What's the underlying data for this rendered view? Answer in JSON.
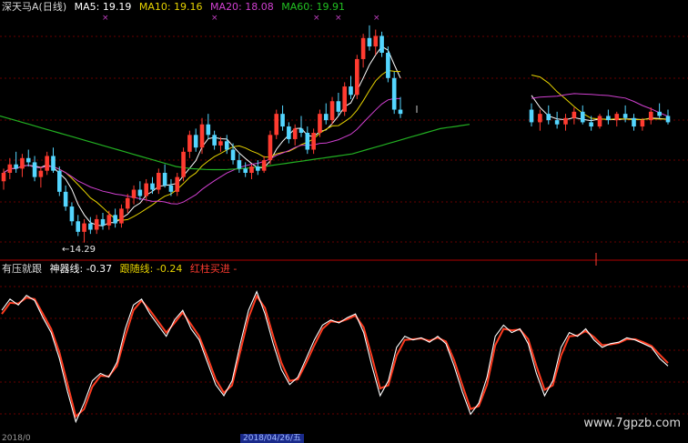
{
  "header": {
    "stock_title": "深天马A(日线)",
    "ma5": "MA5: 19.19",
    "ma10": "MA10: 19.16",
    "ma20": "MA20: 18.08",
    "ma60": "MA60: 19.91"
  },
  "indicator": {
    "name": "有压就跟",
    "shen_label": "神器线: -0.37",
    "gen_label": "跟随线: -0.24",
    "signal_label": "红柱买进 -"
  },
  "annotations": {
    "low_price": "←14.29",
    "date_highlight": "2018/04/26/五",
    "date_left": "2018/0"
  },
  "watermark": "www.7gpzb.com",
  "colors": {
    "up": "#ff3b30",
    "down": "#54d6ff",
    "ma5": "#ffffff",
    "ma10": "#e6d200",
    "ma20": "#d040d0",
    "ma60": "#22b022",
    "osc_main": "#ffffff",
    "osc_follow": "#ff3b1f",
    "grid": "#8b0000"
  },
  "chart_data": {
    "type": "candlestick",
    "ylim": [
      13.8,
      25.2
    ],
    "low_marker": 14.29,
    "candles": [
      {
        "o": 17.2,
        "h": 17.8,
        "l": 16.8,
        "c": 17.6
      },
      {
        "o": 17.6,
        "h": 18.3,
        "l": 17.3,
        "c": 18.0
      },
      {
        "o": 18.0,
        "h": 18.6,
        "l": 17.6,
        "c": 17.8
      },
      {
        "o": 17.8,
        "h": 18.5,
        "l": 17.4,
        "c": 18.3
      },
      {
        "o": 18.3,
        "h": 18.7,
        "l": 17.9,
        "c": 18.1
      },
      {
        "o": 18.1,
        "h": 18.4,
        "l": 17.2,
        "c": 17.4
      },
      {
        "o": 17.4,
        "h": 17.9,
        "l": 16.9,
        "c": 17.7
      },
      {
        "o": 17.7,
        "h": 18.6,
        "l": 17.5,
        "c": 18.4
      },
      {
        "o": 18.4,
        "h": 18.8,
        "l": 17.6,
        "c": 17.7
      },
      {
        "o": 17.7,
        "h": 17.9,
        "l": 16.5,
        "c": 16.7
      },
      {
        "o": 16.7,
        "h": 17.0,
        "l": 15.8,
        "c": 16.0
      },
      {
        "o": 16.0,
        "h": 16.2,
        "l": 15.1,
        "c": 15.3
      },
      {
        "o": 15.3,
        "h": 15.6,
        "l": 14.6,
        "c": 14.8
      },
      {
        "o": 14.8,
        "h": 15.4,
        "l": 14.29,
        "c": 15.2
      },
      {
        "o": 15.2,
        "h": 15.5,
        "l": 14.7,
        "c": 14.9
      },
      {
        "o": 14.9,
        "h": 15.6,
        "l": 14.7,
        "c": 15.4
      },
      {
        "o": 15.4,
        "h": 15.7,
        "l": 14.9,
        "c": 15.1
      },
      {
        "o": 15.1,
        "h": 15.8,
        "l": 14.9,
        "c": 15.6
      },
      {
        "o": 15.6,
        "h": 15.9,
        "l": 15.0,
        "c": 15.2
      },
      {
        "o": 15.2,
        "h": 16.1,
        "l": 15.0,
        "c": 15.9
      },
      {
        "o": 15.9,
        "h": 16.6,
        "l": 15.7,
        "c": 16.4
      },
      {
        "o": 16.4,
        "h": 17.0,
        "l": 16.1,
        "c": 16.8
      },
      {
        "o": 16.8,
        "h": 17.2,
        "l": 16.3,
        "c": 16.5
      },
      {
        "o": 16.5,
        "h": 17.3,
        "l": 16.3,
        "c": 17.1
      },
      {
        "o": 17.1,
        "h": 17.4,
        "l": 16.6,
        "c": 16.8
      },
      {
        "o": 16.8,
        "h": 17.8,
        "l": 16.6,
        "c": 17.6
      },
      {
        "o": 17.6,
        "h": 18.0,
        "l": 16.9,
        "c": 17.0
      },
      {
        "o": 17.0,
        "h": 17.3,
        "l": 16.5,
        "c": 16.7
      },
      {
        "o": 16.7,
        "h": 17.6,
        "l": 16.5,
        "c": 17.4
      },
      {
        "o": 17.4,
        "h": 18.8,
        "l": 17.2,
        "c": 18.6
      },
      {
        "o": 18.6,
        "h": 19.6,
        "l": 18.3,
        "c": 19.4
      },
      {
        "o": 19.4,
        "h": 19.7,
        "l": 18.6,
        "c": 18.8
      },
      {
        "o": 18.8,
        "h": 20.2,
        "l": 18.5,
        "c": 19.9
      },
      {
        "o": 19.9,
        "h": 20.4,
        "l": 19.2,
        "c": 19.4
      },
      {
        "o": 19.4,
        "h": 19.6,
        "l": 18.7,
        "c": 18.9
      },
      {
        "o": 18.9,
        "h": 19.3,
        "l": 18.6,
        "c": 19.1
      },
      {
        "o": 19.1,
        "h": 19.4,
        "l": 18.5,
        "c": 18.7
      },
      {
        "o": 18.7,
        "h": 19.0,
        "l": 18.0,
        "c": 18.2
      },
      {
        "o": 18.2,
        "h": 18.5,
        "l": 17.6,
        "c": 17.8
      },
      {
        "o": 17.8,
        "h": 18.1,
        "l": 17.4,
        "c": 17.6
      },
      {
        "o": 17.6,
        "h": 18.0,
        "l": 17.3,
        "c": 17.9
      },
      {
        "o": 17.9,
        "h": 18.2,
        "l": 17.5,
        "c": 17.7
      },
      {
        "o": 17.7,
        "h": 18.4,
        "l": 17.6,
        "c": 18.2
      },
      {
        "o": 18.2,
        "h": 19.6,
        "l": 18.0,
        "c": 19.4
      },
      {
        "o": 19.4,
        "h": 20.6,
        "l": 19.2,
        "c": 20.4
      },
      {
        "o": 20.4,
        "h": 20.8,
        "l": 19.6,
        "c": 19.8
      },
      {
        "o": 19.8,
        "h": 20.0,
        "l": 19.0,
        "c": 19.2
      },
      {
        "o": 19.2,
        "h": 19.9,
        "l": 18.9,
        "c": 19.7
      },
      {
        "o": 19.7,
        "h": 20.3,
        "l": 19.3,
        "c": 19.5
      },
      {
        "o": 19.5,
        "h": 19.8,
        "l": 18.5,
        "c": 18.7
      },
      {
        "o": 18.7,
        "h": 19.7,
        "l": 18.5,
        "c": 19.5
      },
      {
        "o": 19.5,
        "h": 20.6,
        "l": 19.3,
        "c": 20.4
      },
      {
        "o": 20.4,
        "h": 20.9,
        "l": 19.9,
        "c": 20.1
      },
      {
        "o": 20.1,
        "h": 21.2,
        "l": 19.9,
        "c": 21.0
      },
      {
        "o": 21.0,
        "h": 21.4,
        "l": 20.3,
        "c": 20.5
      },
      {
        "o": 20.5,
        "h": 21.9,
        "l": 20.3,
        "c": 21.7
      },
      {
        "o": 21.7,
        "h": 22.2,
        "l": 21.1,
        "c": 21.3
      },
      {
        "o": 21.3,
        "h": 23.2,
        "l": 21.1,
        "c": 23.0
      },
      {
        "o": 23.0,
        "h": 24.2,
        "l": 22.6,
        "c": 24.0
      },
      {
        "o": 24.0,
        "h": 24.6,
        "l": 23.4,
        "c": 23.6
      },
      {
        "o": 23.6,
        "h": 24.4,
        "l": 23.2,
        "c": 24.1
      },
      {
        "o": 24.1,
        "h": 24.3,
        "l": 23.1,
        "c": 23.3
      },
      {
        "o": 23.3,
        "h": 23.6,
        "l": 21.9,
        "c": 22.1
      },
      {
        "o": 22.1,
        "h": 22.4,
        "l": 20.4,
        "c": 20.6
      },
      {
        "o": 20.6,
        "h": 21.2,
        "l": 20.2,
        "c": 20.4
      },
      {
        "o": 20.6,
        "h": 20.9,
        "l": 19.8,
        "c": 20.0
      },
      {
        "o": 20.0,
        "h": 20.6,
        "l": 19.6,
        "c": 20.4
      },
      {
        "o": 20.4,
        "h": 20.8,
        "l": 19.9,
        "c": 20.1
      },
      {
        "o": 20.1,
        "h": 20.5,
        "l": 19.7,
        "c": 19.9
      },
      {
        "o": 19.9,
        "h": 20.4,
        "l": 19.6,
        "c": 20.2
      },
      {
        "o": 20.2,
        "h": 20.7,
        "l": 19.9,
        "c": 20.5
      },
      {
        "o": 20.5,
        "h": 20.8,
        "l": 19.9,
        "c": 20.0
      },
      {
        "o": 20.0,
        "h": 20.3,
        "l": 19.6,
        "c": 19.8
      },
      {
        "o": 19.8,
        "h": 20.4,
        "l": 19.7,
        "c": 20.3
      },
      {
        "o": 20.3,
        "h": 20.6,
        "l": 19.9,
        "c": 20.1
      },
      {
        "o": 20.1,
        "h": 20.5,
        "l": 19.8,
        "c": 20.4
      },
      {
        "o": 20.4,
        "h": 20.8,
        "l": 20.0,
        "c": 20.2
      },
      {
        "o": 20.2,
        "h": 20.4,
        "l": 19.6,
        "c": 19.8
      },
      {
        "o": 19.8,
        "h": 20.2,
        "l": 19.6,
        "c": 20.1
      },
      {
        "o": 20.1,
        "h": 20.7,
        "l": 19.9,
        "c": 20.5
      },
      {
        "o": 20.5,
        "h": 20.9,
        "l": 20.2,
        "c": 20.3
      },
      {
        "o": 20.3,
        "h": 20.6,
        "l": 19.9,
        "c": 20.0
      }
    ],
    "ma60": [
      20.3,
      20.2,
      20.1,
      20.0,
      19.9,
      19.8,
      19.7,
      19.6,
      19.5,
      19.4,
      19.3,
      19.2,
      19.1,
      19.0,
      18.9,
      18.8,
      18.7,
      18.6,
      18.5,
      18.4,
      18.3,
      18.2,
      18.1,
      18.0,
      17.9,
      17.85,
      17.8,
      17.78,
      17.76,
      17.75,
      17.75,
      17.76,
      17.78,
      17.8,
      17.83,
      17.86,
      17.9,
      17.95,
      18.0,
      18.05,
      18.1,
      18.15,
      18.2,
      18.25,
      18.3,
      18.35,
      18.4,
      18.45,
      18.5,
      18.6,
      18.7,
      18.8,
      18.9,
      19.0,
      19.1,
      19.2,
      19.3,
      19.4,
      19.5,
      19.6,
      19.7,
      19.75,
      19.8,
      19.85,
      19.9
    ],
    "oscillator_main": [
      0.55,
      0.7,
      0.62,
      0.75,
      0.68,
      0.45,
      0.25,
      -0.1,
      -0.55,
      -0.95,
      -0.7,
      -0.4,
      -0.3,
      -0.35,
      -0.15,
      0.3,
      0.62,
      0.7,
      0.5,
      0.35,
      0.2,
      0.42,
      0.55,
      0.3,
      0.15,
      -0.15,
      -0.45,
      -0.6,
      -0.4,
      0.1,
      0.55,
      0.8,
      0.5,
      0.1,
      -0.25,
      -0.45,
      -0.35,
      -0.1,
      0.15,
      0.35,
      0.42,
      0.38,
      0.45,
      0.5,
      0.25,
      -0.2,
      -0.6,
      -0.4,
      0.05,
      0.2,
      0.15,
      0.18,
      0.12,
      0.2,
      0.1,
      -0.2,
      -0.55,
      -0.85,
      -0.7,
      -0.35,
      0.2,
      0.35,
      0.25,
      0.3,
      0.1,
      -0.3,
      -0.6,
      -0.4,
      0.05,
      0.25,
      0.2,
      0.3,
      0.15,
      0.05,
      0.1,
      0.12,
      0.18,
      0.15,
      0.1,
      0.05,
      -0.1,
      -0.2
    ],
    "oscillator_follow": [
      0.5,
      0.65,
      0.64,
      0.72,
      0.7,
      0.5,
      0.3,
      -0.02,
      -0.45,
      -0.88,
      -0.78,
      -0.48,
      -0.33,
      -0.34,
      -0.2,
      0.2,
      0.55,
      0.68,
      0.55,
      0.4,
      0.25,
      0.38,
      0.52,
      0.36,
      0.2,
      -0.08,
      -0.38,
      -0.56,
      -0.46,
      0.0,
      0.45,
      0.74,
      0.58,
      0.2,
      -0.16,
      -0.4,
      -0.38,
      -0.16,
      0.08,
      0.3,
      0.4,
      0.39,
      0.43,
      0.48,
      0.32,
      -0.08,
      -0.5,
      -0.46,
      -0.06,
      0.15,
      0.16,
      0.17,
      0.14,
      0.18,
      0.13,
      -0.12,
      -0.46,
      -0.78,
      -0.74,
      -0.45,
      0.08,
      0.3,
      0.28,
      0.29,
      0.16,
      -0.2,
      -0.52,
      -0.46,
      -0.06,
      0.2,
      0.21,
      0.27,
      0.19,
      0.08,
      0.09,
      0.11,
      0.16,
      0.16,
      0.12,
      0.07,
      -0.05,
      -0.16
    ]
  }
}
